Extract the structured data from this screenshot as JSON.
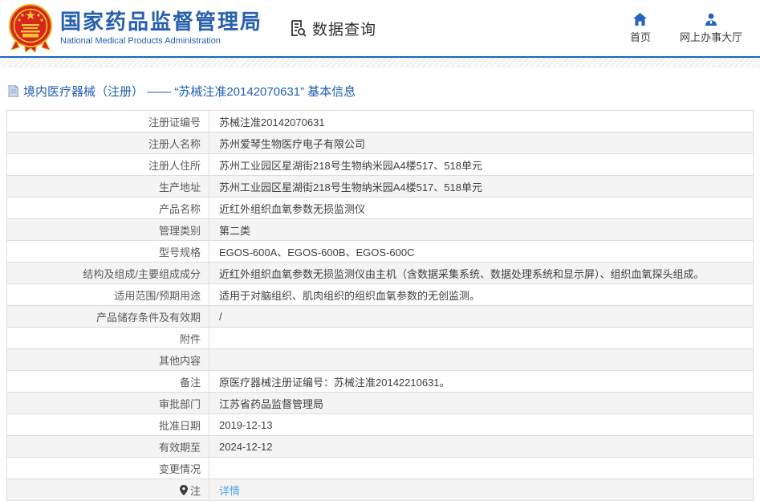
{
  "header": {
    "logo_title": "国家药品监督管理局",
    "logo_subtitle": "National Medical Products Administration",
    "query_label": "数据查询",
    "nav": [
      {
        "label": "首页",
        "icon": "home-icon"
      },
      {
        "label": "网上办事大厅",
        "icon": "person-icon"
      }
    ]
  },
  "page": {
    "title": "境内医疗器械（注册） —— “苏械注准20142070631” 基本信息"
  },
  "table": {
    "rows": [
      {
        "label": "注册证编号",
        "value": "苏械注准20142070631"
      },
      {
        "label": "注册人名称",
        "value": "苏州爱琴生物医疗电子有限公司"
      },
      {
        "label": "注册人住所",
        "value": "苏州工业园区星湖街218号生物纳米园A4楼517、518单元"
      },
      {
        "label": "生产地址",
        "value": "苏州工业园区星湖街218号生物纳米园A4楼517、518单元"
      },
      {
        "label": "产品名称",
        "value": "近红外组织血氧参数无损监测仪"
      },
      {
        "label": "管理类别",
        "value": "第二类"
      },
      {
        "label": "型号规格",
        "value": "EGOS-600A、EGOS-600B、EGOS-600C"
      },
      {
        "label": "结构及组成/主要组成成分",
        "value": "近红外组织血氧参数无损监测仪由主机（含数据采集系统、数据处理系统和显示屏）、组织血氧探头组成。"
      },
      {
        "label": "适用范围/预期用途",
        "value": "适用于对脑组织、肌肉组织的组织血氧参数的无创监测。"
      },
      {
        "label": "产品储存条件及有效期",
        "value": "/"
      },
      {
        "label": "附件",
        "value": ""
      },
      {
        "label": "其他内容",
        "value": ""
      },
      {
        "label": "备注",
        "value": "原医疗器械注册证编号：苏械注准20142210631。"
      },
      {
        "label": "审批部门",
        "value": "江苏省药品监督管理局"
      },
      {
        "label": "批准日期",
        "value": "2019-12-13"
      },
      {
        "label": "有效期至",
        "value": "2024-12-12"
      },
      {
        "label": "变更情况",
        "value": ""
      },
      {
        "label": "注",
        "value": "详情"
      }
    ]
  },
  "icons": {
    "logo": "national-emblem",
    "query": "document-search-icon",
    "nav_home": "home-icon",
    "nav_hall": "person-icon",
    "title": "document-icon",
    "note_row": "pin-icon"
  },
  "colors": {
    "brand_blue": "#2760ae",
    "header_rule_blue": "#1565c0",
    "title_blue": "#1e5eb4",
    "link_blue": "#4da3e8",
    "row_stripe": "#f4f4f4",
    "table_border": "#dcdcdc",
    "emblem_red": "#d7261d",
    "emblem_gold": "#f3c632",
    "nav_icon_blue": "#2563c0"
  }
}
